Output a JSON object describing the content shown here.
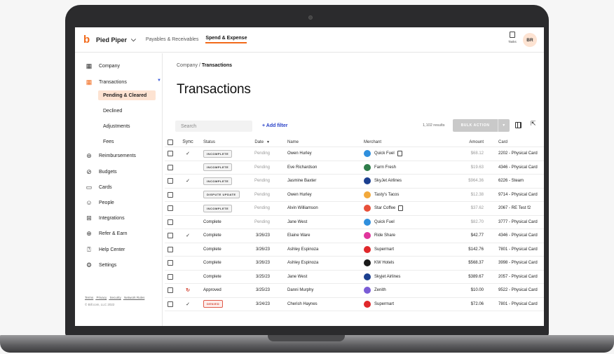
{
  "app": {
    "org_name": "Pied Piper",
    "nav_tabs": [
      "Payables & Receivables",
      "Spend & Expense"
    ],
    "tasks_label": "Tasks",
    "avatar_initials": "BR",
    "brand_color": "#f26a1b"
  },
  "sidebar": {
    "items": [
      {
        "label": "Company",
        "icon": "building-icon"
      },
      {
        "label": "Transactions",
        "icon": "transactions-icon"
      },
      {
        "label": "Reimbursements",
        "icon": "reimburse-icon"
      },
      {
        "label": "Budgets",
        "icon": "budget-icon"
      },
      {
        "label": "Cards",
        "icon": "card-icon"
      },
      {
        "label": "People",
        "icon": "people-icon"
      },
      {
        "label": "Integrations",
        "icon": "integrations-icon"
      },
      {
        "label": "Refer & Earn",
        "icon": "gift-icon"
      },
      {
        "label": "Help Center",
        "icon": "help-icon"
      },
      {
        "label": "Settings",
        "icon": "gear-icon"
      }
    ],
    "sub_items": [
      "Pending & Cleared",
      "Declined",
      "Adjustments",
      "Fees"
    ],
    "footer_links": [
      "Terms",
      "Privacy",
      "Security",
      "Network Rules"
    ],
    "copyright": "© Bill.com, LLC 2022"
  },
  "main": {
    "breadcrumb_parent": "Company",
    "breadcrumb_current": "Transactions",
    "title": "Transactions",
    "search_placeholder": "Search",
    "add_filter": "+ Add filter",
    "results": "1,102 results",
    "bulk_action": "BULK ACTION"
  },
  "table": {
    "headers": {
      "sync": "Sync",
      "status": "Status",
      "date": "Date",
      "name": "Name",
      "merchant": "Merchant",
      "amount": "Amount",
      "card": "Card"
    },
    "rows": [
      {
        "sync": "✓",
        "status": "INCOMPLETE",
        "pill": true,
        "date": "Pending",
        "name": "Owen Hurley",
        "merchant": "Quick Fuel",
        "mcolor": "#2f8fdd",
        "receipt": true,
        "amount": "$68.12",
        "card": "2202 - Physical Card"
      },
      {
        "sync": "",
        "status": "INCOMPLETE",
        "pill": true,
        "date": "Pending",
        "name": "Eve Richardson",
        "merchant": "Farm Fresh",
        "mcolor": "#2f7d4a",
        "receipt": false,
        "amount": "$19.63",
        "card": "4346 - Physical Card"
      },
      {
        "sync": "✓",
        "status": "INCOMPLETE",
        "pill": true,
        "date": "Pending",
        "name": "Jasmine Baxter",
        "merchant": "SkyJet Airlines",
        "mcolor": "#1b3f8f",
        "receipt": false,
        "amount": "$964.36",
        "card": "6226 - Steam"
      },
      {
        "sync": "",
        "status": "DISPUTE UPDATE",
        "pill": true,
        "date": "Pending",
        "name": "Owen Hurley",
        "merchant": "Tasty's Tacos",
        "mcolor": "#f2a93b",
        "receipt": false,
        "amount": "$12.38",
        "card": "9714 - Physical Card"
      },
      {
        "sync": "",
        "status": "INCOMPLETE",
        "pill": true,
        "date": "Pending",
        "name": "Alvin Williamson",
        "merchant": "Star Coffee",
        "mcolor": "#e8503a",
        "receipt": true,
        "amount": "$37.62",
        "card": "2067 - RE Test f2"
      },
      {
        "sync": "",
        "status": "Complete",
        "pill": false,
        "date": "Pending",
        "name": "Jane West",
        "merchant": "Quick Fuel",
        "mcolor": "#2f8fdd",
        "receipt": false,
        "amount": "$82.70",
        "card": "3777 - Physical Card"
      },
      {
        "sync": "✓",
        "status": "Complete",
        "pill": false,
        "date": "3/26/23",
        "name": "Elaine Ware",
        "merchant": "Ride Share",
        "mcolor": "#e0359c",
        "receipt": false,
        "amount": "$42.77",
        "card": "4346 - Physical Card"
      },
      {
        "sync": "",
        "status": "Complete",
        "pill": false,
        "date": "3/26/23",
        "name": "Ashley Espinoza",
        "merchant": "Supermart",
        "mcolor": "#e0282b",
        "receipt": false,
        "amount": "$142.76",
        "card": "7801 - Physical Card"
      },
      {
        "sync": "",
        "status": "Complete",
        "pill": false,
        "date": "3/26/23",
        "name": "Ashley Espinoza",
        "merchant": "KW Hotels",
        "mcolor": "#1a1a1a",
        "receipt": false,
        "amount": "$568.37",
        "card": "3998 - Physical Card"
      },
      {
        "sync": "",
        "status": "Complete",
        "pill": false,
        "date": "3/25/23",
        "name": "Jane West",
        "merchant": "Skyjet Airlines",
        "mcolor": "#1b3f8f",
        "receipt": false,
        "amount": "$389.67",
        "card": "2057 - Physical Card"
      },
      {
        "sync": "↻",
        "status": "Approved",
        "pill": false,
        "date": "3/25/23",
        "name": "Danni Murphy",
        "merchant": "Zenith",
        "mcolor": "#7a5cd6",
        "receipt": false,
        "amount": "$10.00",
        "card": "9522 - Physical Card"
      },
      {
        "sync": "✓",
        "status": "DENIED",
        "pill": true,
        "denied": true,
        "date": "3/24/23",
        "name": "Cherish Haynes",
        "merchant": "Supermart",
        "mcolor": "#e0282b",
        "receipt": false,
        "amount": "$72.06",
        "card": "7801 - Physical Card"
      }
    ]
  }
}
